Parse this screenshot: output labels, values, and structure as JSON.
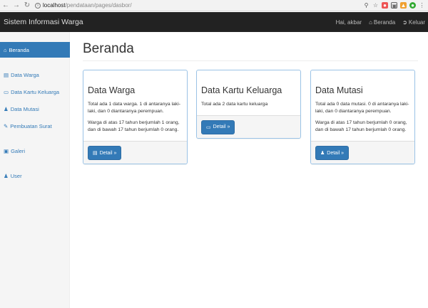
{
  "browser": {
    "url_host": "localhost",
    "url_path": "/pendataan/pages/dasbor/"
  },
  "navbar": {
    "brand": "Sistem Informasi Warga",
    "greeting": "Hai, akbar",
    "home_label": "Beranda",
    "logout_label": "Keluar"
  },
  "sidebar": {
    "items": [
      {
        "label": "Beranda",
        "icon": "home-icon"
      },
      {
        "label": "Data Warga",
        "icon": "book-icon"
      },
      {
        "label": "Data Kartu Keluarga",
        "icon": "card-icon"
      },
      {
        "label": "Data Mutasi",
        "icon": "user-icon"
      },
      {
        "label": "Pembuatan Surat",
        "icon": "pencil-icon"
      },
      {
        "label": "Galeri",
        "icon": "picture-icon"
      },
      {
        "label": "User",
        "icon": "user-icon"
      }
    ]
  },
  "main": {
    "title": "Beranda",
    "panels": [
      {
        "title": "Data Warga",
        "p1": "Total ada 1 data warga. 1 di antaranya laki-laki, dan 0 diantaranya perempuan.",
        "p2": "Warga di atas 17 tahun berjumlah 1 orang, dan di bawah 17 tahun berjumlah 0 orang.",
        "button": "Detail »"
      },
      {
        "title": "Data Kartu Keluarga",
        "p1": "Total ada 2 data kartu keluarga",
        "button": "Detail »"
      },
      {
        "title": "Data Mutasi",
        "p1": "Total ada 0 data mutasi. 0 di antaranya laki-laki, dan 0 diantaranya perempuan.",
        "p2": "Warga di atas 17 tahun berjumlah 0 orang, dan di bawah 17 tahun berjumlah 0 orang.",
        "button": "Detail »"
      }
    ]
  },
  "colors": {
    "accent": "#337ab7",
    "navbar": "#222222",
    "sidebar": "#f5f5f5"
  }
}
